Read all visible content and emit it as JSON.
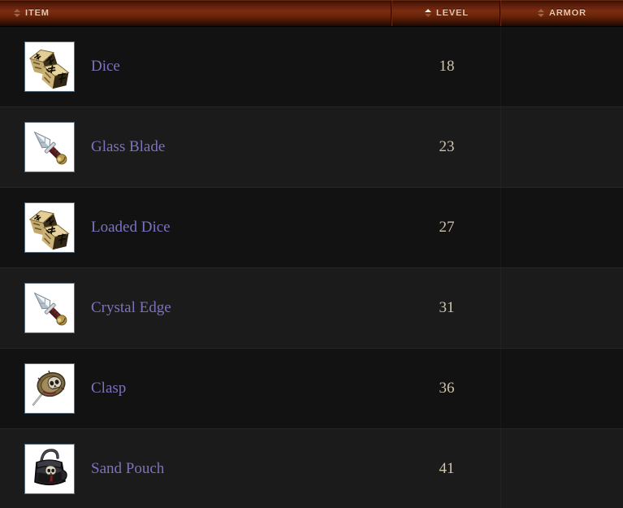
{
  "table": {
    "columns": [
      {
        "key": "item",
        "label": "ITEM",
        "sort_icon": "sort-updown-icon",
        "sort_state": "none"
      },
      {
        "key": "level",
        "label": "LEVEL",
        "sort_icon": "sort-updown-icon",
        "sort_state": "asc"
      },
      {
        "key": "armor",
        "label": "ARMOR",
        "sort_icon": "sort-updown-icon",
        "sort_state": "none"
      }
    ],
    "rows": [
      {
        "icon": "dice-icon",
        "name": "Dice",
        "level": "18",
        "armor": ""
      },
      {
        "icon": "dagger-icon",
        "name": "Glass Blade",
        "level": "23",
        "armor": ""
      },
      {
        "icon": "dice-icon",
        "name": "Loaded Dice",
        "level": "27",
        "armor": ""
      },
      {
        "icon": "dagger-icon",
        "name": "Crystal Edge",
        "level": "31",
        "armor": ""
      },
      {
        "icon": "clasp-pin-icon",
        "name": "Clasp",
        "level": "36",
        "armor": ""
      },
      {
        "icon": "pouch-icon",
        "name": "Sand Pouch",
        "level": "41",
        "armor": ""
      }
    ]
  },
  "colors": {
    "header_accent": "#7a2c10",
    "header_text": "#f0c9ae",
    "link": "#7b73bd",
    "value_text": "#cfc4ab",
    "row_bg": "#121212",
    "row_bg_alt": "#1b1b1b",
    "icon_border": "#5a6f80"
  }
}
